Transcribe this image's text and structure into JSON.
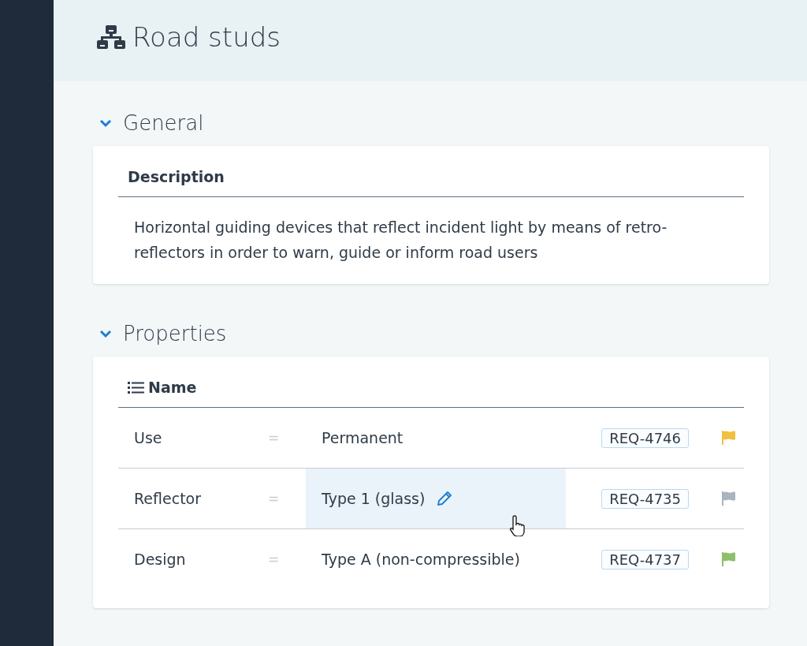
{
  "page": {
    "title": "Road studs"
  },
  "sections": [
    {
      "title": "General",
      "expanded": true,
      "kind": "description",
      "heading": "Description",
      "text": "Horizontal guiding devices that reflect incident light by means of retro-reflectors in order to warn, guide or inform road users"
    },
    {
      "title": "Properties",
      "expanded": true,
      "kind": "table",
      "heading": "Name",
      "rows": [
        {
          "name": "Use",
          "operator": "=",
          "value": "Permanent",
          "requirement": "REQ-4746",
          "color": "#f0c040",
          "highlighted": false
        },
        {
          "name": "Reflector",
          "operator": "=",
          "value": "Type 1 (glass)",
          "requirement": "REQ-4735",
          "color": "#aab4be",
          "highlighted": true
        },
        {
          "name": "Design",
          "operator": "=",
          "value": "Type A (non-compressible)",
          "requirement": "REQ-4737",
          "color": "#8fbf6a",
          "highlighted": false
        }
      ]
    }
  ]
}
